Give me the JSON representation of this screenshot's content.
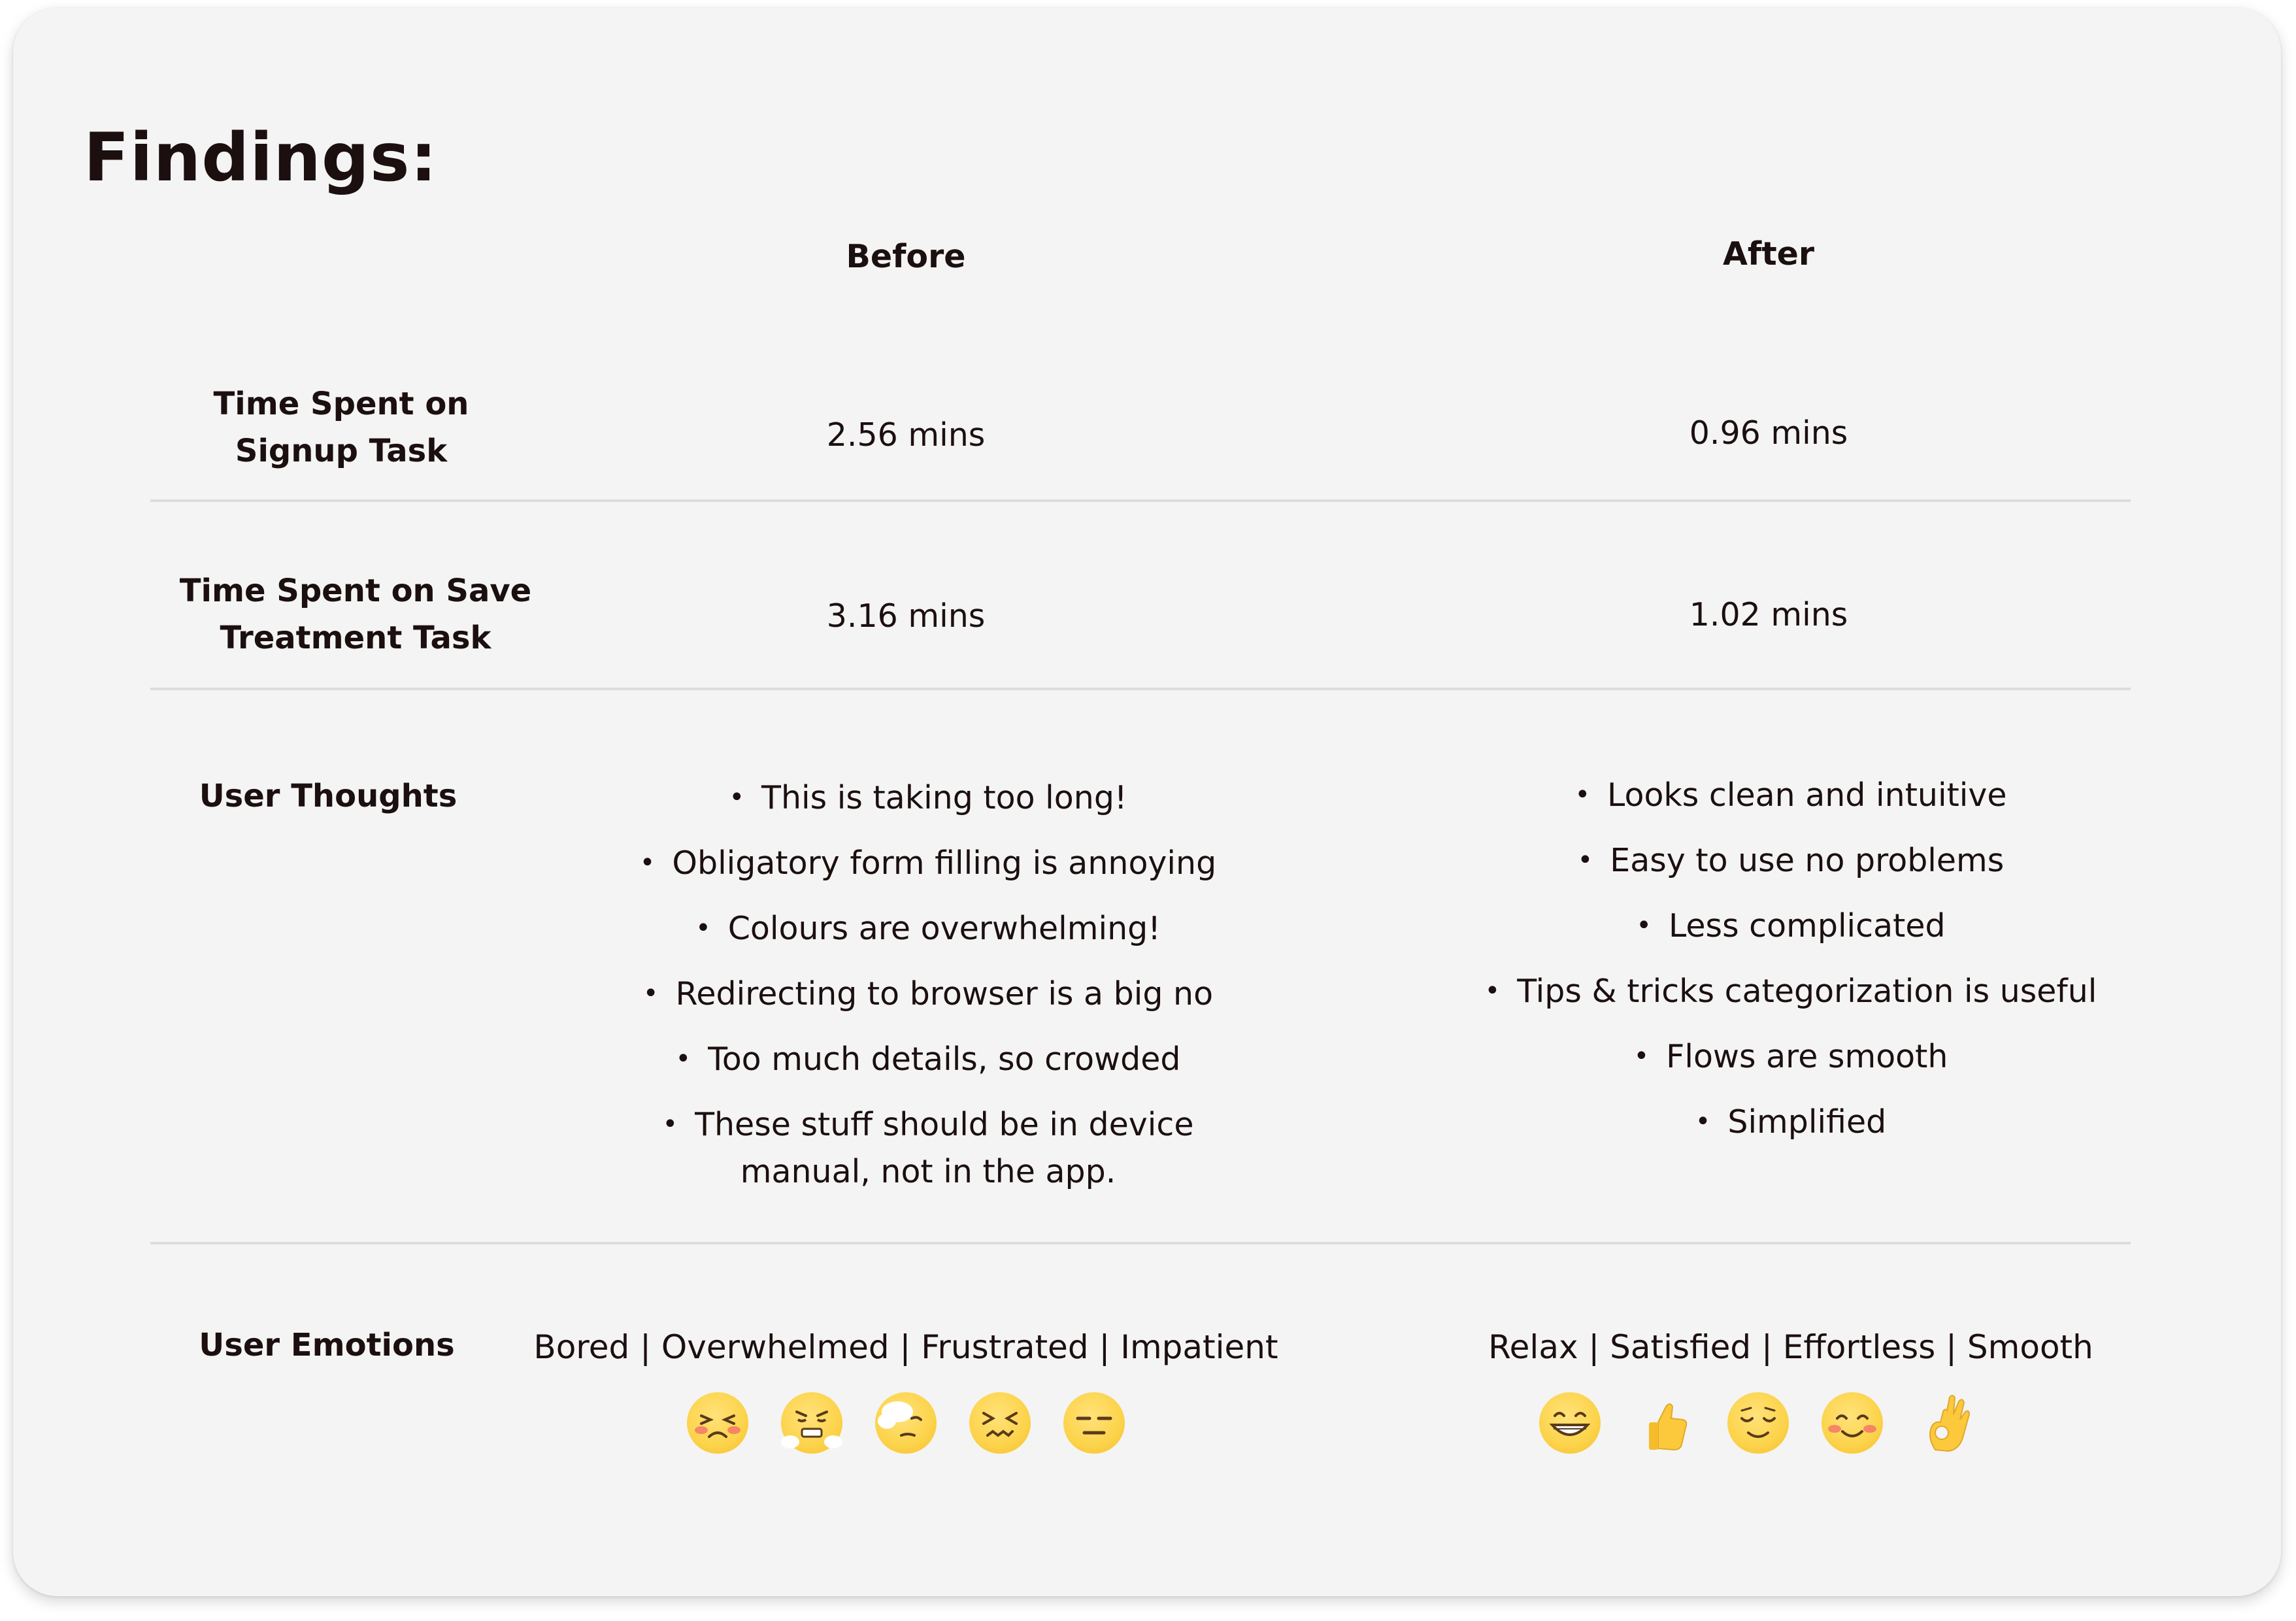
{
  "title": "Findings:",
  "columns": {
    "before": "Before",
    "after": "After"
  },
  "rows": {
    "signup": {
      "label_line1": "Time Spent on",
      "label_line2": "Signup Task",
      "before": "2.56 mins",
      "after": "0.96 mins"
    },
    "save": {
      "label_line1": "Time Spent on Save",
      "label_line2": "Treatment Task",
      "before": "3.16 mins",
      "after": "1.02 mins"
    },
    "thoughts": {
      "label": "User Thoughts",
      "before": [
        "This is taking too long!",
        "Obligatory form filling is annoying",
        "Colours are overwhelming!",
        "Redirecting to browser is a big no",
        "Too much details, so crowded",
        "These stuff should be in device",
        "manual, not in the app."
      ],
      "after": [
        "Looks clean and intuitive",
        "Easy to use no problems",
        "Less complicated",
        "Tips & tricks categorization is useful",
        "Flows are smooth",
        "Simplified"
      ]
    },
    "emotions": {
      "label": "User Emotions",
      "before": "Bored | Overwhelmed | Frustrated | Impatient",
      "after": "Relax | Satisfied | Effortless | Smooth",
      "before_icons": [
        "tired-face-icon",
        "steam-nose-face-icon",
        "face-in-clouds-icon",
        "confounded-face-icon",
        "expressionless-face-icon"
      ],
      "after_icons": [
        "grinning-face-icon",
        "thumbs-up-icon",
        "relieved-face-icon",
        "smiling-face-icon",
        "ok-hand-icon"
      ]
    }
  },
  "colors": {
    "background": "#f4f4f4",
    "text": "#1c0f0f",
    "divider": "#dcdcdc",
    "emoji_yellow": "#fcd34a"
  }
}
